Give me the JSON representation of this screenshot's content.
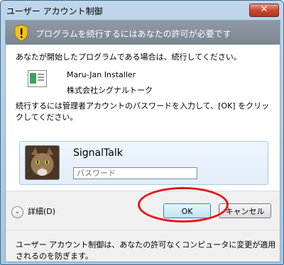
{
  "window": {
    "title": "ユーザー アカウント制御",
    "close_label": "✕"
  },
  "banner": {
    "text": "プログラムを続行するにはあなたの許可が必要です"
  },
  "message": {
    "intro": "あなたが開始したプログラムである場合は、続行してください。",
    "instruction": "続行するには管理者アカウントのパスワードを入力して、[OK] をクリックしてください。"
  },
  "program": {
    "name": "Maru-Jan Installer",
    "publisher": "株式会社シグナルトーク"
  },
  "credential": {
    "username": "SignalTalk",
    "password_placeholder": "パスワード",
    "password_value": ""
  },
  "footer": {
    "details_label": "詳細(D)",
    "ok_label": "OK",
    "cancel_label": "キャンセル",
    "note": "ユーザー アカウント制御は、あなたの許可なくコンピュータに変更が適用されるのを防ぎます。"
  },
  "colors": {
    "annotation_ring": "#e5141b",
    "banner": "#8a95a1"
  },
  "icons": {
    "shield": "uac-shield-icon",
    "program": "program-icon",
    "details": "chevron-down-icon"
  }
}
